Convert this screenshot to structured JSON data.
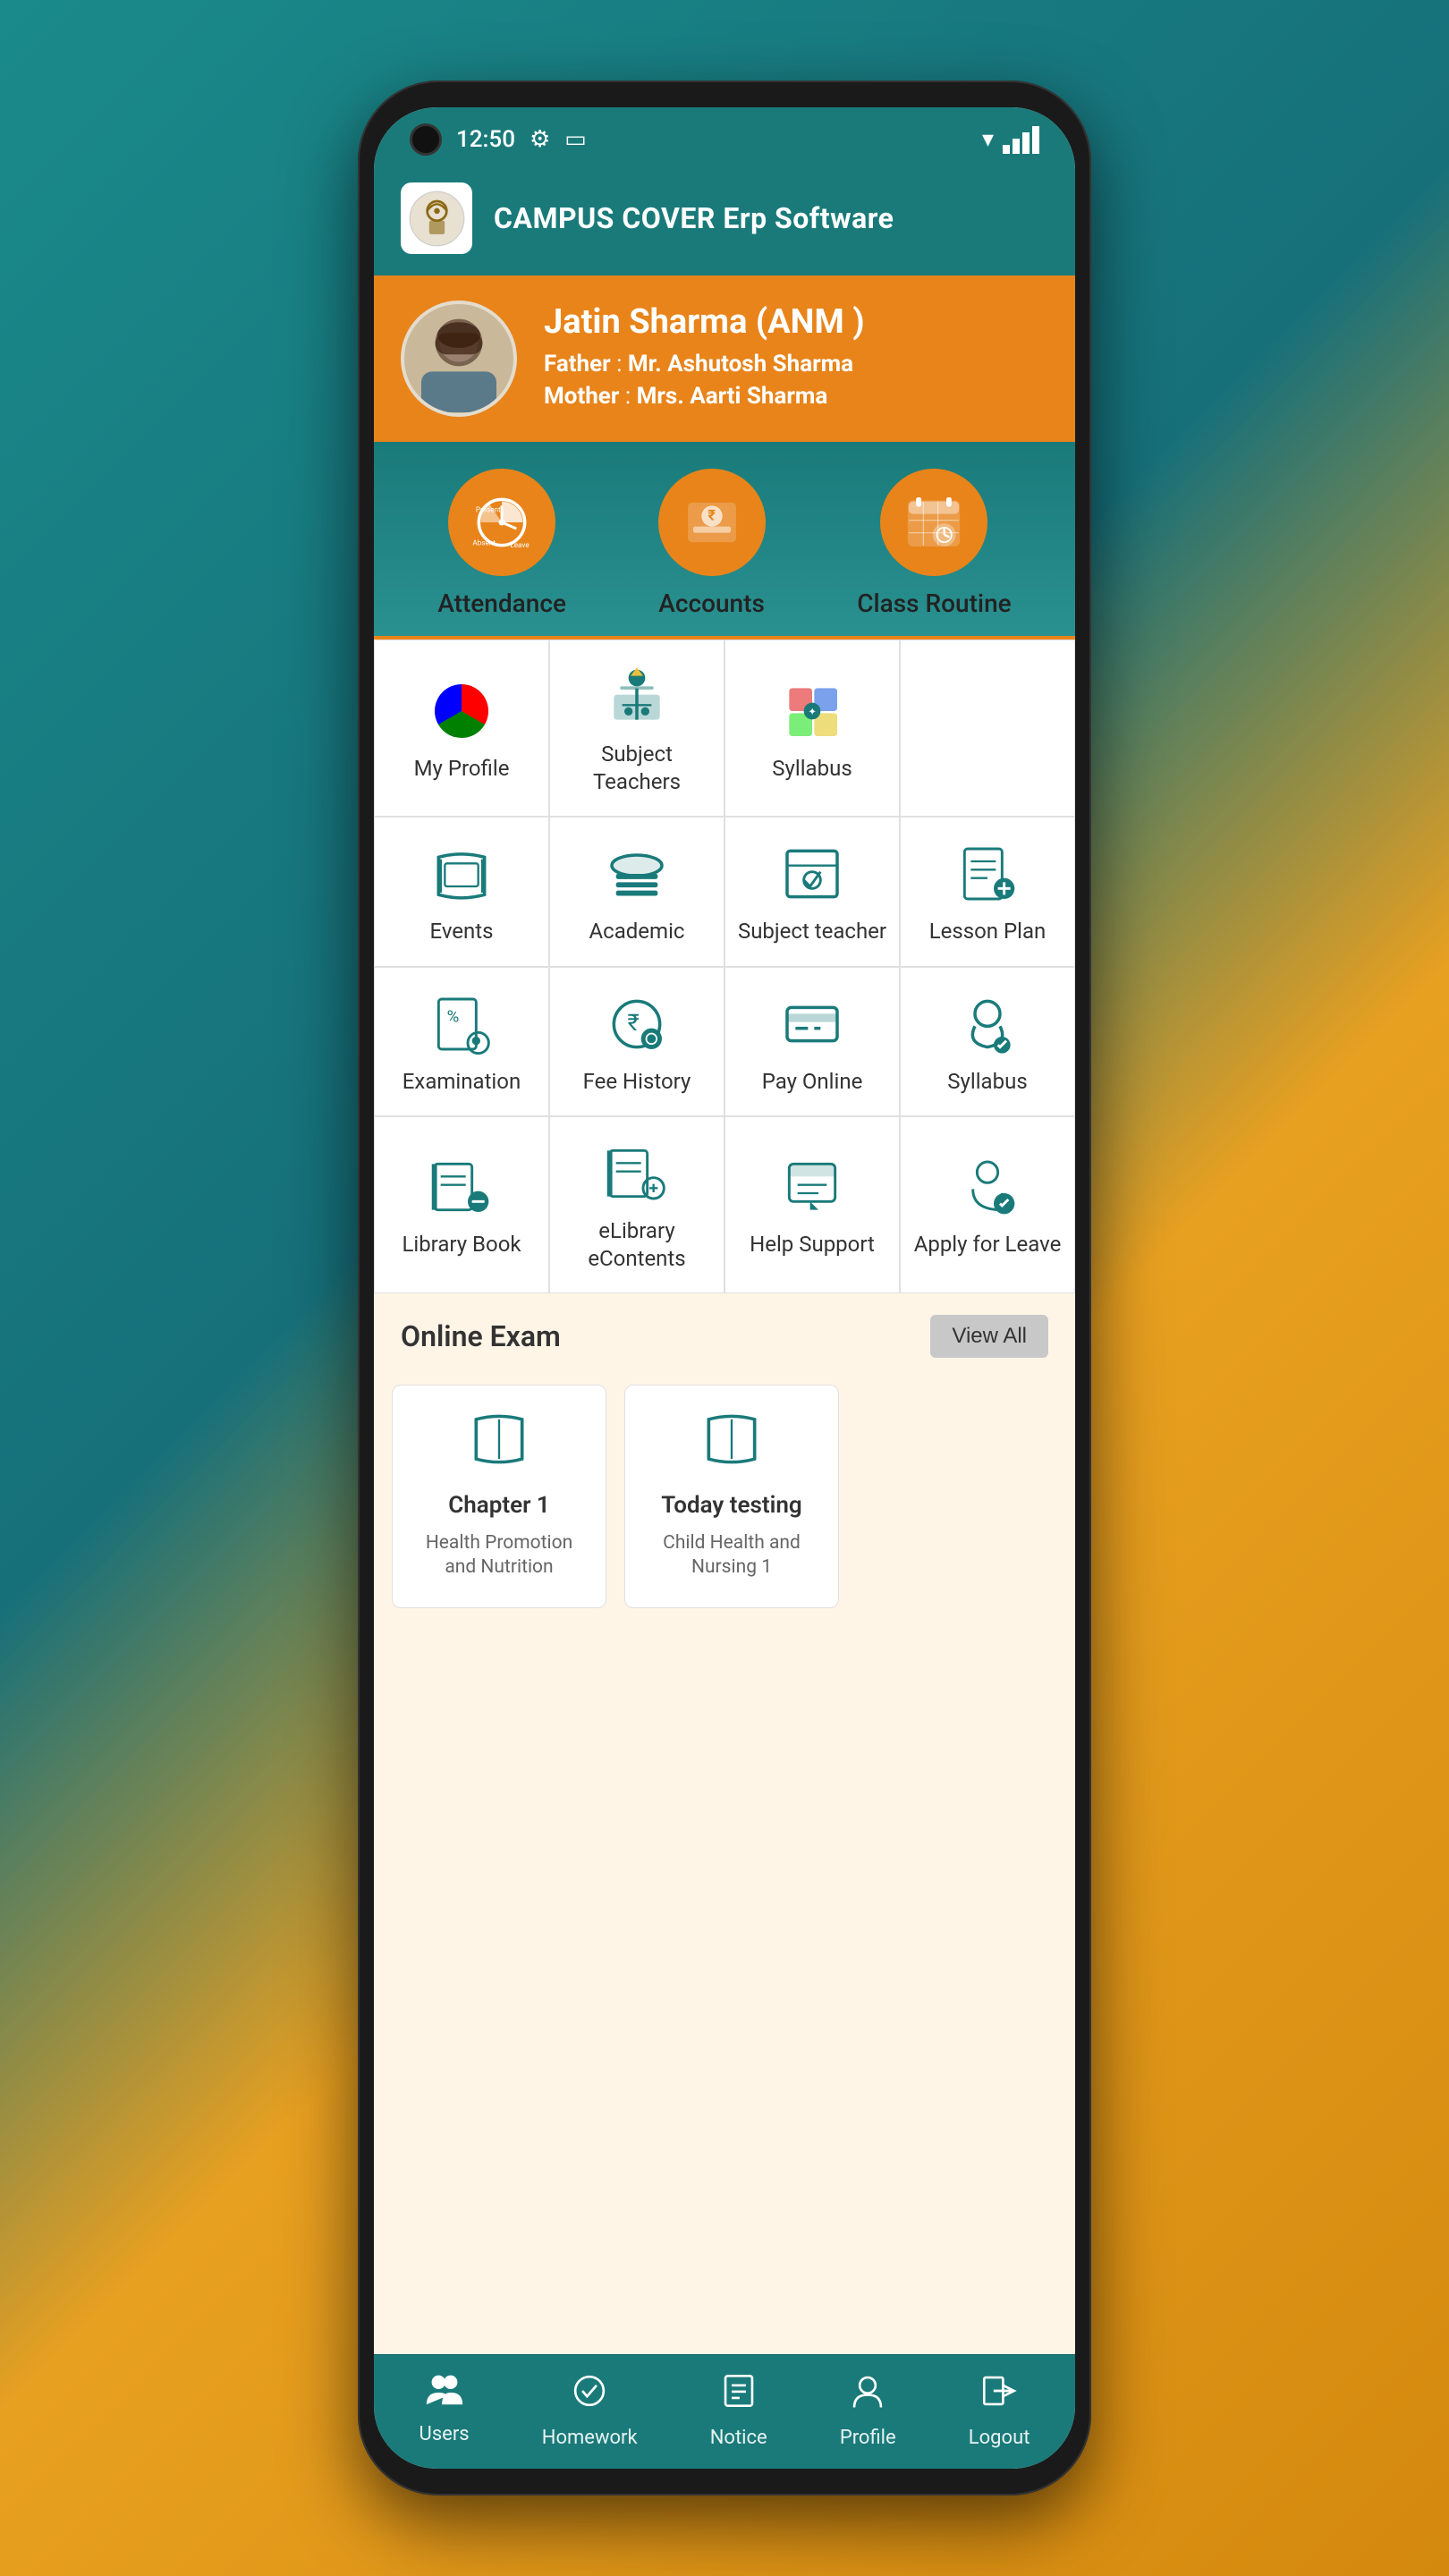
{
  "status": {
    "time": "12:50",
    "wifi": "▼▲",
    "battery": "🔋"
  },
  "header": {
    "title": "CAMPUS COVER Erp Software",
    "logo_icon": "🏫"
  },
  "profile": {
    "name": "Jatin Sharma (ANM )",
    "father_label": "Father",
    "father_name": "Mr. Ashutosh Sharma",
    "mother_label": "Mother",
    "mother_name": "Mrs. Aarti Sharma"
  },
  "quick_icons": [
    {
      "id": "attendance",
      "label": "Attendance"
    },
    {
      "id": "accounts",
      "label": "Accounts"
    },
    {
      "id": "class-routine",
      "label": "Class Routine"
    }
  ],
  "menu_items": [
    {
      "id": "my-profile",
      "label": "My Profile",
      "icon": "profile"
    },
    {
      "id": "subject-teachers",
      "label": "Subject Teachers",
      "icon": "teachers"
    },
    {
      "id": "syllabus1",
      "label": "Syllabus",
      "icon": "syllabus"
    },
    {
      "id": "empty1",
      "label": "",
      "icon": "none"
    },
    {
      "id": "events",
      "label": "Events",
      "icon": "events"
    },
    {
      "id": "academic",
      "label": "Academic",
      "icon": "academic"
    },
    {
      "id": "subject-teacher",
      "label": "Subject teacher",
      "icon": "subject-teacher"
    },
    {
      "id": "lesson-plan",
      "label": "Lesson Plan",
      "icon": "lesson-plan"
    },
    {
      "id": "examination",
      "label": "Examination",
      "icon": "examination"
    },
    {
      "id": "fee-history",
      "label": "Fee History",
      "icon": "fee-history"
    },
    {
      "id": "pay-online",
      "label": "Pay Online",
      "icon": "pay-online"
    },
    {
      "id": "syllabus2",
      "label": "Syllabus",
      "icon": "syllabus2"
    },
    {
      "id": "library-book",
      "label": "Library Book",
      "icon": "library"
    },
    {
      "id": "elibrary",
      "label": "eLibrary eContents",
      "icon": "elibrary"
    },
    {
      "id": "help-support",
      "label": "Help Support",
      "icon": "help"
    },
    {
      "id": "apply-leave",
      "label": "Apply for Leave",
      "icon": "leave"
    }
  ],
  "online_exam": {
    "section_title": "Online Exam",
    "view_all": "View All",
    "cards": [
      {
        "id": "chapter1",
        "title": "Chapter 1",
        "subtitle": "Health Promotion and Nutrition"
      },
      {
        "id": "today-testing",
        "title": "Today testing",
        "subtitle": "Child Health and Nursing 1"
      }
    ]
  },
  "bottom_nav": [
    {
      "id": "users",
      "label": "Users",
      "icon": "users"
    },
    {
      "id": "homework",
      "label": "Homework",
      "icon": "homework"
    },
    {
      "id": "notice",
      "label": "Notice",
      "icon": "notice"
    },
    {
      "id": "profile",
      "label": "Profile",
      "icon": "profile-nav"
    },
    {
      "id": "logout",
      "label": "Logout",
      "icon": "logout"
    }
  ]
}
